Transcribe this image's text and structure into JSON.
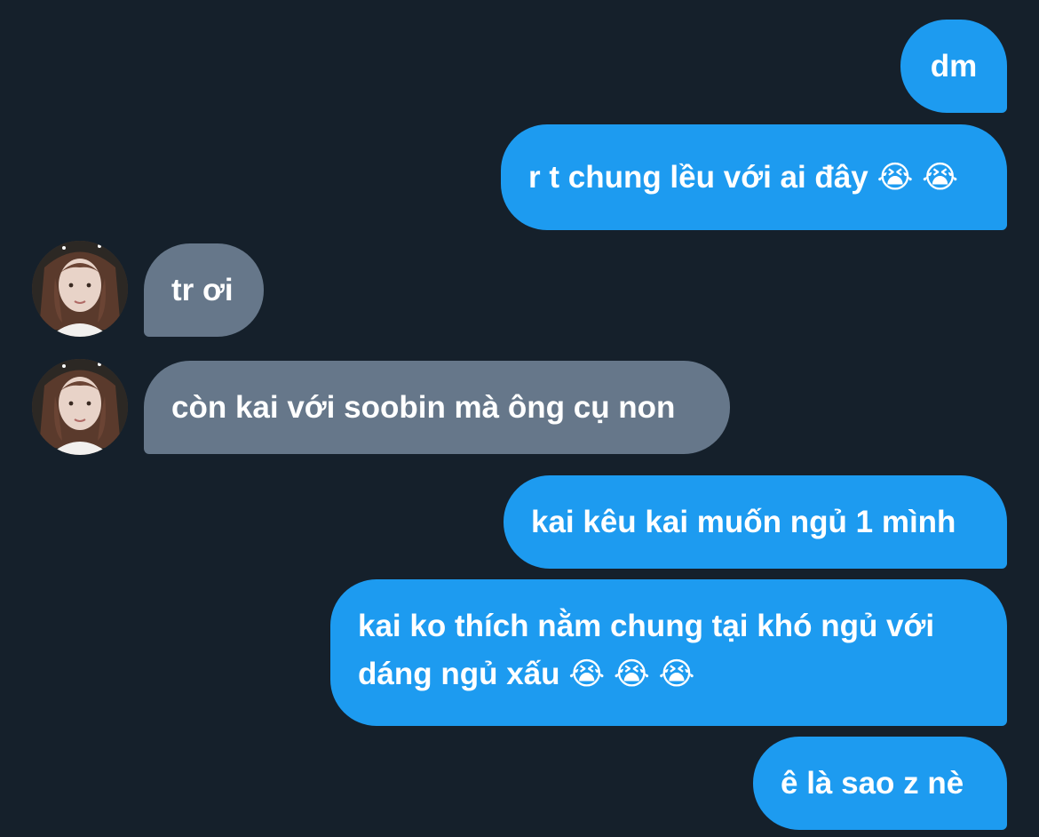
{
  "messages": [
    {
      "side": "sent",
      "lines": [
        "dm"
      ]
    },
    {
      "side": "sent",
      "lines": [
        "r t chung lều với ai đây 😭 😭"
      ]
    },
    {
      "side": "received",
      "lines": [
        "tr ơi"
      ]
    },
    {
      "side": "received",
      "lines": [
        "còn kai với soobin mà ông cụ non"
      ]
    },
    {
      "side": "sent",
      "lines": [
        "kai kêu kai muốn ngủ 1 mình"
      ]
    },
    {
      "side": "sent",
      "lines": [
        "kai ko thích nằm chung tại khó ngủ với",
        "dáng ngủ xấu 😭 😭 😭"
      ]
    },
    {
      "side": "sent",
      "lines": [
        "ê là sao z nè"
      ]
    }
  ],
  "colors": {
    "background": "#15202b",
    "sent_bubble": "#1d9bf0",
    "received_bubble": "#66778a",
    "text": "#ffffff"
  },
  "avatar": {
    "icon": "profile-photo-avatar"
  }
}
